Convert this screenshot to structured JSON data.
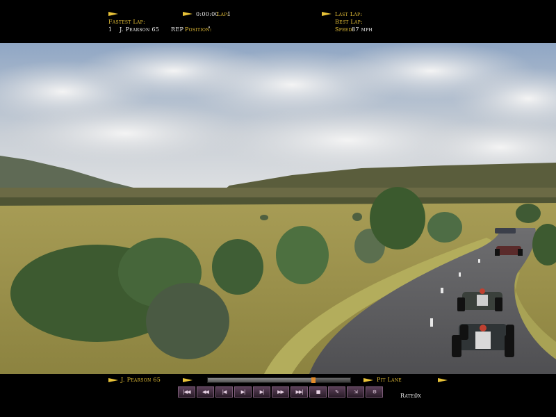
{
  "hud": {
    "timer": "0:00:00",
    "lap_label": "Lap:",
    "lap_value": "1",
    "fastest_lap_label": "Fastest Lap:",
    "leader_position": "1",
    "leader_name": "J. Pearson 65",
    "rep_label": "REP",
    "position_label": "Position:",
    "position_value": "\"",
    "last_lap_label": "Last Lap:",
    "best_lap_label": "Best Lap:",
    "speed_label": "Speed:",
    "speed_value": "87 mph"
  },
  "bottom": {
    "driver_name": "J. Pearson 65",
    "pit_lane_label": "Pit Lane",
    "rate_label": "Rate:",
    "rate_value": "0x",
    "replay_progress": 0.74
  },
  "controls": [
    {
      "name": "rewind-to-start-button",
      "glyph": "|◀◀"
    },
    {
      "name": "fast-rewind-button",
      "glyph": "◀◀"
    },
    {
      "name": "step-back-button",
      "glyph": "|◀"
    },
    {
      "name": "play-pause-button",
      "glyph": "▶|"
    },
    {
      "name": "play-button",
      "glyph": "▶|"
    },
    {
      "name": "fast-forward-button",
      "glyph": "▶▶"
    },
    {
      "name": "skip-to-end-button",
      "glyph": "▶▶|"
    },
    {
      "name": "camera-mark-button",
      "glyph": "■"
    },
    {
      "name": "edit-marker-button",
      "glyph": "✎"
    },
    {
      "name": "export-button",
      "glyph": "⇲"
    },
    {
      "name": "settings-button",
      "glyph": "⚙"
    }
  ],
  "colors": {
    "hud_label": "#e8c238",
    "hud_value": "#f2f2f2",
    "button_bg": "#3d2b3b",
    "progress_knob": "#e38b2a"
  }
}
